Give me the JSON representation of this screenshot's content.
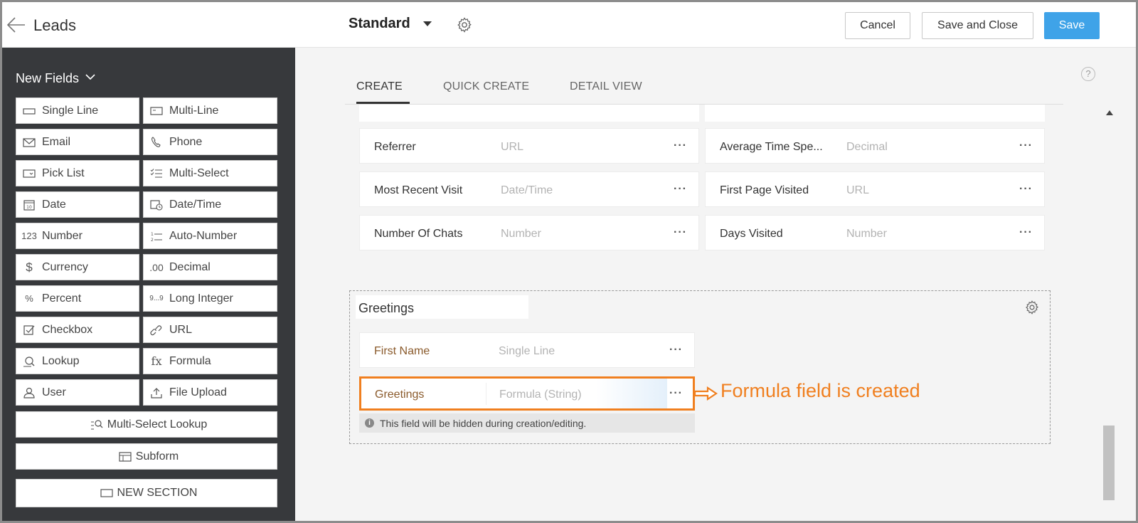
{
  "topbar": {
    "module_title": "Leads",
    "layout_name": "Standard",
    "cancel_label": "Cancel",
    "save_close_label": "Save and Close",
    "save_label": "Save",
    "accent_color": "#3fa3e8"
  },
  "sidebar": {
    "heading": "New Fields",
    "fields": [
      {
        "label": "Single Line",
        "icon": "single-line-icon"
      },
      {
        "label": "Multi-Line",
        "icon": "multi-line-icon"
      },
      {
        "label": "Email",
        "icon": "email-icon"
      },
      {
        "label": "Phone",
        "icon": "phone-icon"
      },
      {
        "label": "Pick List",
        "icon": "picklist-icon"
      },
      {
        "label": "Multi-Select",
        "icon": "multi-select-icon"
      },
      {
        "label": "Date",
        "icon": "date-icon"
      },
      {
        "label": "Date/Time",
        "icon": "datetime-icon"
      },
      {
        "label": "Number",
        "icon_text": "123"
      },
      {
        "label": "Auto-Number",
        "icon": "auto-number-icon"
      },
      {
        "label": "Currency",
        "icon_text": "$"
      },
      {
        "label": "Decimal",
        "icon_text": ".00"
      },
      {
        "label": "Percent",
        "icon_text": "%"
      },
      {
        "label": "Long Integer",
        "icon_text": "9...9"
      },
      {
        "label": "Checkbox",
        "icon": "checkbox-icon"
      },
      {
        "label": "URL",
        "icon": "url-icon"
      },
      {
        "label": "Lookup",
        "icon": "lookup-icon"
      },
      {
        "label": "Formula",
        "icon_text": "fx"
      },
      {
        "label": "User",
        "icon": "user-icon"
      },
      {
        "label": "File Upload",
        "icon": "file-upload-icon"
      }
    ],
    "multi_select_lookup": "Multi-Select Lookup",
    "subform": "Subform",
    "new_section": "NEW SECTION"
  },
  "tabs": [
    {
      "label": "CREATE",
      "active": true
    },
    {
      "label": "QUICK CREATE",
      "active": false
    },
    {
      "label": "DETAIL VIEW",
      "active": false
    }
  ],
  "visitor_fields": [
    {
      "label": "Referrer",
      "type": "URL"
    },
    {
      "label": "Average Time Spe...",
      "type": "Decimal"
    },
    {
      "label": "Most Recent Visit",
      "type": "Date/Time"
    },
    {
      "label": "First Page Visited",
      "type": "URL"
    },
    {
      "label": "Number Of Chats",
      "type": "Number"
    },
    {
      "label": "Days Visited",
      "type": "Number"
    }
  ],
  "greetings_section": {
    "title": "Greetings",
    "fields": [
      {
        "label": "First Name",
        "type": "Single Line"
      },
      {
        "label": "Greetings",
        "type": "Formula (String)"
      }
    ],
    "hint": "This field will be hidden during creation/editing."
  },
  "annotation": {
    "text": "Formula field is created",
    "color": "#f07f1f"
  }
}
